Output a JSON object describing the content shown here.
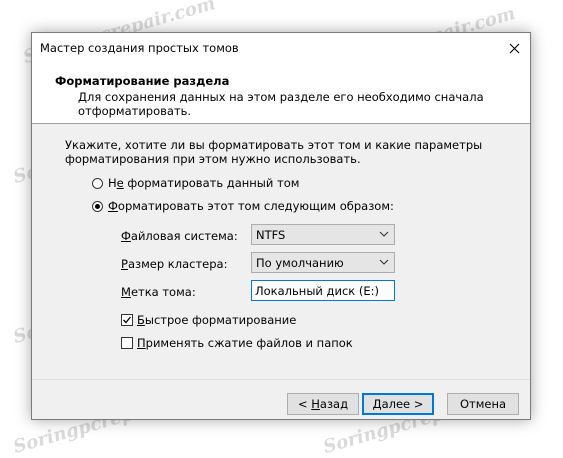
{
  "window": {
    "title": "Мастер создания простых томов"
  },
  "header": {
    "title": "Форматирование раздела",
    "description": "Для сохранения данных на этом разделе его необходимо сначала отформатировать."
  },
  "prompt": "Укажите, хотите ли вы форматировать этот том и какие параметры форматирования при этом нужно использовать.",
  "options": {
    "no_format": {
      "pre": "Н",
      "accel": "е",
      "post": " форматировать данный том"
    },
    "format": {
      "pre": "",
      "accel": "Ф",
      "post": "орматировать этот том следующим образом:"
    }
  },
  "fields": {
    "filesystem": {
      "accel": "Ф",
      "label_rest": "айловая система:",
      "value": "NTFS"
    },
    "cluster": {
      "accel": "Р",
      "label_rest": "азмер кластера:",
      "value": "По умолчанию"
    },
    "volume_label": {
      "accel": "М",
      "label_rest": "етка тома:",
      "value": "Локальный диск (E:)"
    }
  },
  "checkboxes": {
    "quick_format": {
      "accel": "Б",
      "label_rest": "ыстрое форматирование",
      "checked": true
    },
    "compression": {
      "accel": "П",
      "label_rest": "рименять сжатие файлов и папок",
      "checked": false
    }
  },
  "buttons": {
    "back": {
      "prefix": "< ",
      "accel": "Н",
      "rest": "азад"
    },
    "next": {
      "accel": "Д",
      "rest": "алее >"
    },
    "cancel": "Отмена"
  },
  "watermark": "Soringpcrepair.com"
}
